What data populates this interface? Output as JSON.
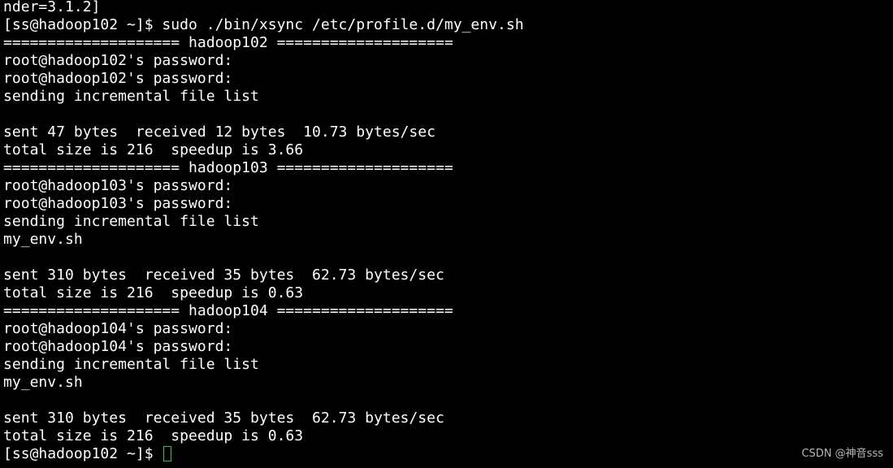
{
  "terminal": {
    "lines": [
      "nder=3.1.2]",
      "[ss@hadoop102 ~]$ sudo ./bin/xsync /etc/profile.d/my_env.sh",
      "==================== hadoop102 ====================",
      "root@hadoop102's password:",
      "root@hadoop102's password:",
      "sending incremental file list",
      "",
      "sent 47 bytes  received 12 bytes  10.73 bytes/sec",
      "total size is 216  speedup is 3.66",
      "==================== hadoop103 ====================",
      "root@hadoop103's password:",
      "root@hadoop103's password:",
      "sending incremental file list",
      "my_env.sh",
      "",
      "sent 310 bytes  received 35 bytes  62.73 bytes/sec",
      "total size is 216  speedup is 0.63",
      "==================== hadoop104 ====================",
      "root@hadoop104's password:",
      "root@hadoop104's password:",
      "sending incremental file list",
      "my_env.sh",
      "",
      "sent 310 bytes  received 35 bytes  62.73 bytes/sec",
      "total size is 216  speedup is 0.63"
    ],
    "prompt": "[ss@hadoop102 ~]$ ",
    "cursor_color": "#22c55e",
    "background_color": "#000000",
    "text_color": "#ffffff"
  },
  "watermark": {
    "text": "CSDN @神音sss"
  }
}
